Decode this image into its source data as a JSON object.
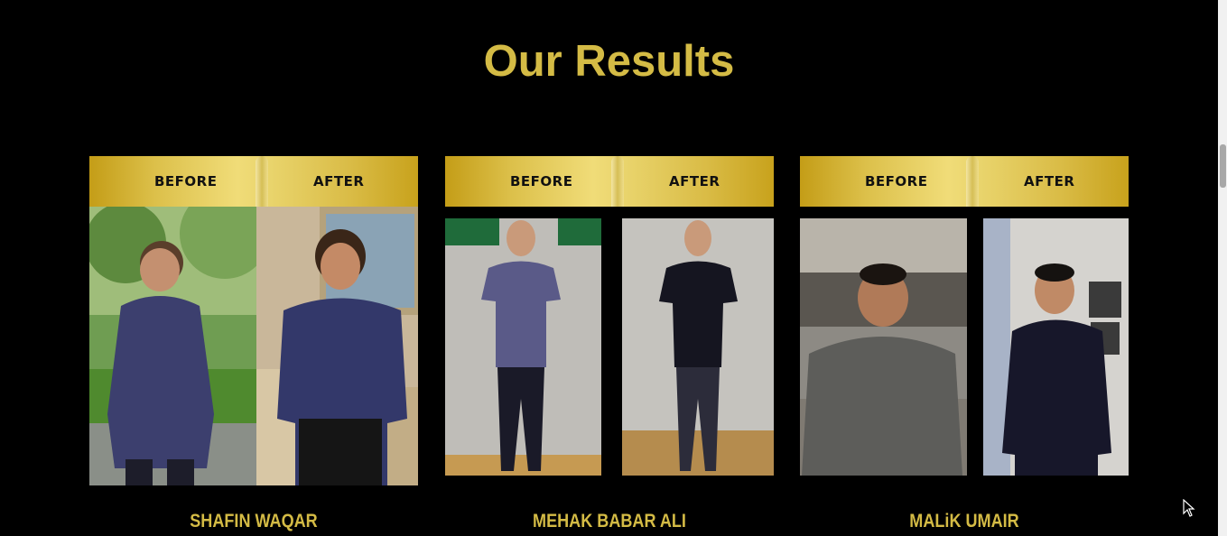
{
  "section": {
    "title": "Our Results"
  },
  "results": [
    {
      "before_label": "BEFORE",
      "after_label": "AFTER",
      "name": "SHAFIN WAQAR",
      "before_image": "man-in-navy-kurta-garden-photo",
      "after_image": "man-in-navy-sweater-indoor-photo"
    },
    {
      "before_label": "BEFORE",
      "after_label": "AFTER",
      "name": "MEHAK BABAR ALI",
      "before_image": "woman-in-purple-tshirt-pegboard-photo",
      "after_image": "woman-in-black-tshirt-pegboard-photo"
    },
    {
      "before_label": "BEFORE",
      "after_label": "AFTER",
      "name": "MALiK UMAIR",
      "before_image": "man-in-grey-polo-crowd-photo",
      "after_image": "man-in-black-tshirt-brickwall-photo"
    }
  ],
  "colors": {
    "background": "#000000",
    "accent_gold": "#d4bb45"
  }
}
